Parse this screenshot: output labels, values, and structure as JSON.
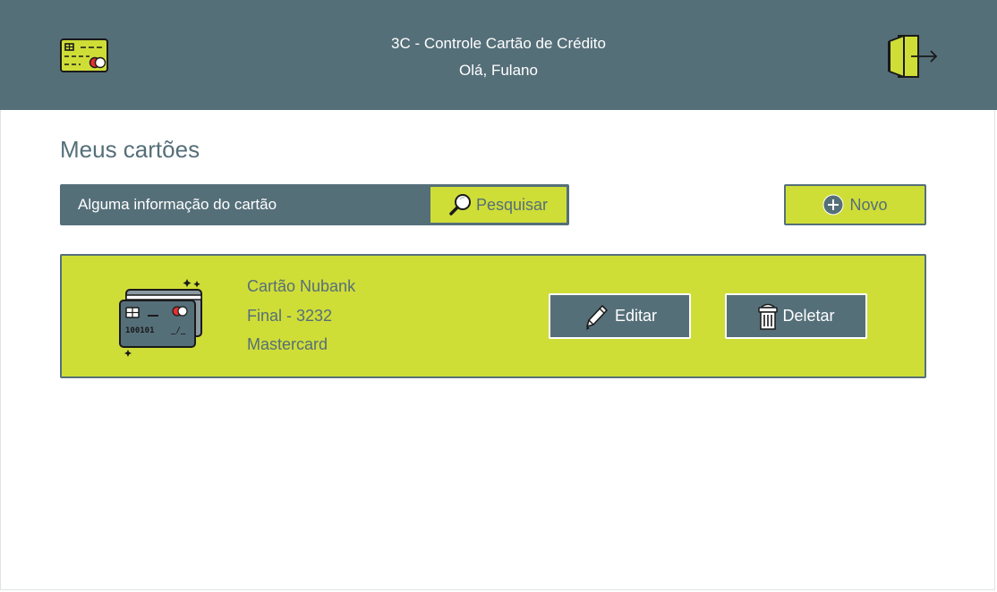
{
  "header": {
    "app_title": "3C - Controle Cartão de Crédito",
    "greeting": "Olá, Fulano",
    "logo_icon": "credit-card-icon",
    "logout_icon": "logout-door-icon"
  },
  "main": {
    "page_title": "Meus cartões",
    "search": {
      "placeholder": "Alguma informação do cartão",
      "value": "",
      "button_label": "Pesquisar",
      "button_icon": "magnifier-icon"
    },
    "new_button": {
      "label": "Novo",
      "icon": "plus-circle-icon"
    },
    "cards": [
      {
        "name": "Cartão Nubank",
        "final": "Final - 3232",
        "brand": "Mastercard",
        "illustration": "credit-cards-illustration",
        "edit_label": "Editar",
        "edit_icon": "pencil-icon",
        "delete_label": "Deletar",
        "delete_icon": "trash-icon"
      }
    ]
  },
  "colors": {
    "primary": "#556f79",
    "accent": "#cfdd37",
    "background": "#ffffff",
    "text_light": "#ffffff"
  }
}
